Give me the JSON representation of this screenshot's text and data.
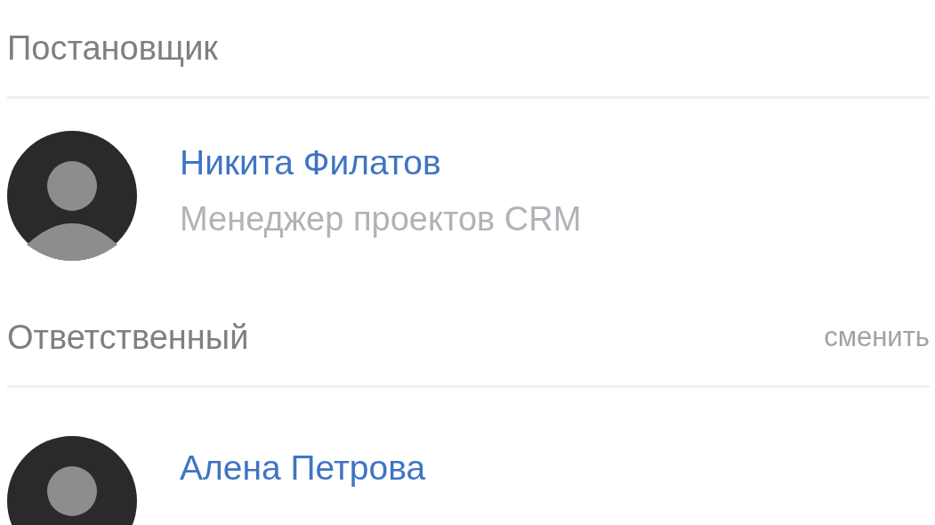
{
  "sections": [
    {
      "title": "Постановщик",
      "person": {
        "name": "Никита Филатов",
        "role": "Менеджер проектов CRM"
      }
    },
    {
      "title": "Ответственный",
      "action": "сменить",
      "person": {
        "name": "Алена Петрова"
      }
    }
  ]
}
